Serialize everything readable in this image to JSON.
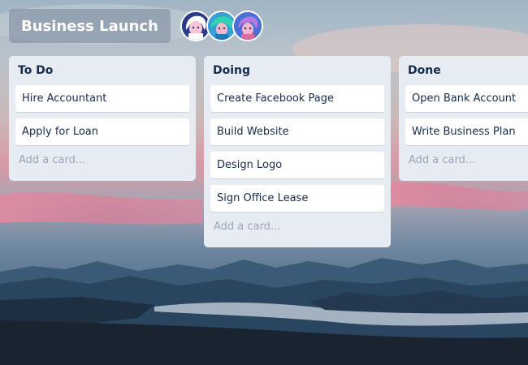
{
  "board": {
    "title": "Business Launch",
    "members": [
      {
        "icon": "member-avatar-white-hair",
        "color": "#2b3a8a"
      },
      {
        "icon": "member-avatar-teal-hair",
        "color": "#3a9fd6"
      },
      {
        "icon": "member-avatar-purple-hair",
        "color": "#4a6fd6"
      }
    ]
  },
  "lists": [
    {
      "title": "To Do",
      "cards": [
        "Hire Accountant",
        "Apply for Loan"
      ],
      "add_label": "Add a card..."
    },
    {
      "title": "Doing",
      "cards": [
        "Create Facebook Page",
        "Build Website",
        "Design Logo",
        "Sign Office Lease"
      ],
      "add_label": "Add a card..."
    },
    {
      "title": "Done",
      "cards": [
        "Open Bank Account",
        "Write Business Plan"
      ],
      "add_label": "Add a card..."
    }
  ],
  "colors": {
    "list_background": "#e7ecf3",
    "card_background": "#ffffff",
    "text": "#172b4d",
    "placeholder": "#9aa5b8"
  }
}
